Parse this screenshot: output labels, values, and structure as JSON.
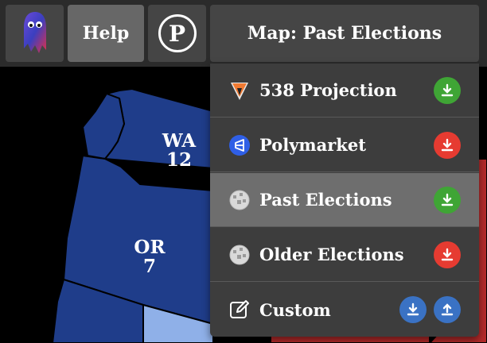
{
  "toolbar": {
    "help_label": "Help",
    "party_button_glyph": "P",
    "map_menu_label": "Map: Past Elections"
  },
  "dropdown": {
    "items": [
      {
        "label": "538 Projection",
        "icon": "538-logo-icon",
        "actions": [
          {
            "type": "download",
            "color": "#3fa535"
          }
        ],
        "selected": false
      },
      {
        "label": "Polymarket",
        "icon": "polymarket-logo-icon",
        "actions": [
          {
            "type": "download",
            "color": "#e63b31"
          }
        ],
        "selected": false
      },
      {
        "label": "Past Elections",
        "icon": "wikipedia-globe-icon",
        "actions": [
          {
            "type": "download",
            "color": "#3fa535"
          }
        ],
        "selected": true
      },
      {
        "label": "Older Elections",
        "icon": "wikipedia-globe-icon",
        "actions": [
          {
            "type": "download",
            "color": "#e63b31"
          }
        ],
        "selected": false
      },
      {
        "label": "Custom",
        "icon": "edit-icon",
        "actions": [
          {
            "type": "download",
            "color": "#3a72c4"
          },
          {
            "type": "upload",
            "color": "#3a72c4"
          }
        ],
        "selected": false
      }
    ]
  },
  "map": {
    "states": [
      {
        "abbr": "WA",
        "ev": "12",
        "color": "#1f3d8a"
      },
      {
        "abbr": "OR",
        "ev": "7",
        "color": "#1f3d8a"
      }
    ],
    "colors": {
      "safe_dem": "#1f3d8a",
      "lean_dem": "#8fb0e8",
      "safe_rep": "#b52a2a"
    }
  }
}
